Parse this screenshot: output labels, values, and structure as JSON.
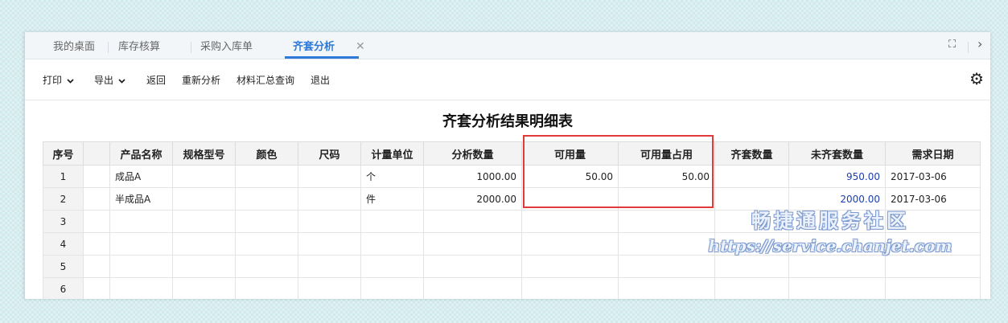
{
  "tabs": [
    {
      "label": "我的桌面"
    },
    {
      "label": "库存核算"
    },
    {
      "label": "采购入库单"
    },
    {
      "label": "齐套分析",
      "close": "✕"
    }
  ],
  "tabbar_right": {
    "maximize_icon": "⛶",
    "more_icon": "›"
  },
  "toolbar": {
    "print": "打印",
    "export": "导出",
    "back": "返回",
    "reanalyze": "重新分析",
    "material_query": "材料汇总查询",
    "exit": "退出",
    "settings_icon": "⚙"
  },
  "report_title": "齐套分析结果明细表",
  "table": {
    "headers": [
      "序号",
      "",
      "产品名称",
      "规格型号",
      "颜色",
      "尺码",
      "计量单位",
      "分析数量",
      "可用量",
      "可用量占用",
      "齐套数量",
      "未齐套数量",
      "需求日期"
    ],
    "rows": [
      [
        "1",
        "",
        "成品A",
        "",
        "",
        "",
        "个",
        "1000.00",
        "50.00",
        "50.00",
        "",
        "950.00",
        "2017-03-06"
      ],
      [
        "2",
        "",
        "半成品A",
        "",
        "",
        "",
        "件",
        "2000.00",
        "",
        "",
        "",
        "2000.00",
        "2017-03-06"
      ],
      [
        "3",
        "",
        "",
        "",
        "",
        "",
        "",
        "",
        "",
        "",
        "",
        "",
        ""
      ],
      [
        "4",
        "",
        "",
        "",
        "",
        "",
        "",
        "",
        "",
        "",
        "",
        "",
        ""
      ],
      [
        "5",
        "",
        "",
        "",
        "",
        "",
        "",
        "",
        "",
        "",
        "",
        "",
        ""
      ],
      [
        "6",
        "",
        "",
        "",
        "",
        "",
        "",
        "",
        "",
        "",
        "",
        "",
        ""
      ]
    ]
  },
  "watermark": {
    "line1": "畅捷通服务社区",
    "line2": "https://service.chanjet.com"
  },
  "colors": {
    "accent": "#2f7ad8",
    "highlight": "#e03a3a",
    "blue_value": "#1a3fb0"
  }
}
